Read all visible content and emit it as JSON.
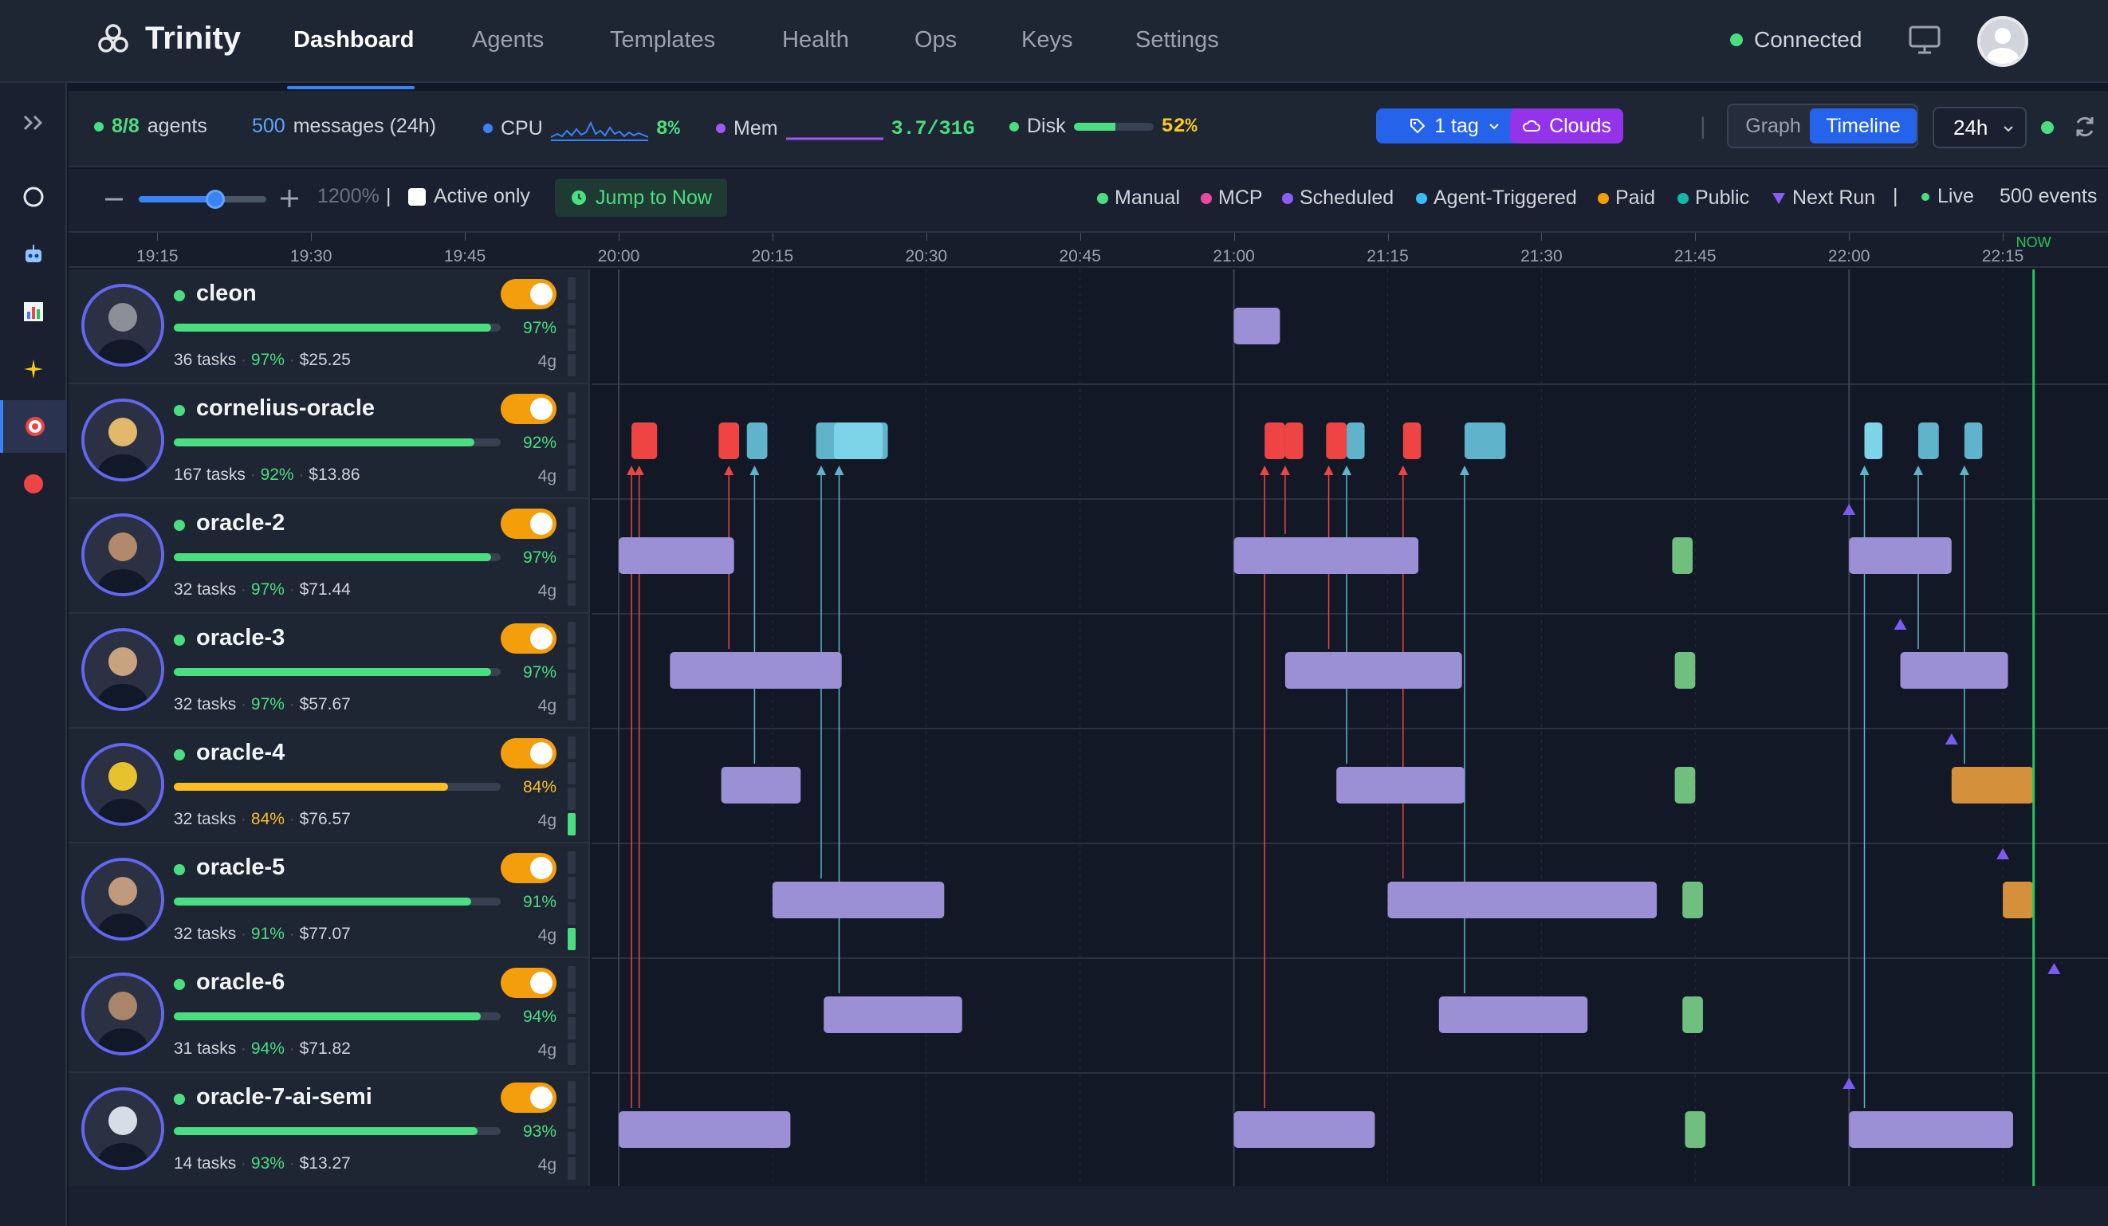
{
  "app": {
    "title": "Trinity"
  },
  "nav": {
    "tabs": [
      {
        "label": "Dashboard",
        "active": true
      },
      {
        "label": "Agents"
      },
      {
        "label": "Templates"
      },
      {
        "label": "Health"
      },
      {
        "label": "Ops"
      },
      {
        "label": "Keys"
      },
      {
        "label": "Settings"
      }
    ],
    "connection": "Connected",
    "connection_color": "#4ade80"
  },
  "rail": {
    "items": [
      {
        "icon": "expand-sidebar-icon"
      },
      {
        "icon": "circle-icon"
      },
      {
        "icon": "robot-icon"
      },
      {
        "icon": "bar-chart-icon"
      },
      {
        "icon": "sparkles-icon"
      },
      {
        "icon": "target-icon",
        "active": true
      },
      {
        "icon": "record-icon"
      }
    ]
  },
  "stats": {
    "agents_count": "8/8",
    "agents_label": "agents",
    "messages_count": "500",
    "messages_label": "messages (24h)",
    "cpu_label": "CPU",
    "cpu_value": "8%",
    "mem_label": "Mem",
    "mem_value": "3.7/31G",
    "disk_label": "Disk",
    "disk_value": "52%",
    "disk_fill": 0.52,
    "tag_filter": "1 tag",
    "clouds_filter": "Clouds",
    "view_graph": "Graph",
    "view_timeline": "Timeline",
    "range": "24h"
  },
  "toolbar": {
    "zoom": "1200%",
    "zoom_level": 0.6,
    "active_only": "Active only",
    "jump_to_now": "Jump to Now",
    "legend": [
      {
        "label": "Manual",
        "color": "#4ade80",
        "shape": "dot"
      },
      {
        "label": "MCP",
        "color": "#ec4899",
        "shape": "dot"
      },
      {
        "label": "Scheduled",
        "color": "#8b5cf6",
        "shape": "dot"
      },
      {
        "label": "Agent-Triggered",
        "color": "#38bdf8",
        "shape": "dot"
      },
      {
        "label": "Paid",
        "color": "#f59e0b",
        "shape": "dot"
      },
      {
        "label": "Public",
        "color": "#14b8a6",
        "shape": "dot"
      },
      {
        "label": "Next Run",
        "color": "#8b5cf6",
        "shape": "triangle"
      }
    ],
    "live": "Live",
    "events": "500 events"
  },
  "axis": {
    "ticks": [
      "19:15",
      "19:30",
      "19:45",
      "20:00",
      "20:15",
      "20:30",
      "20:45",
      "21:00",
      "21:15",
      "21:30",
      "21:45",
      "22:00",
      "22:15"
    ],
    "now_label": "NOW"
  },
  "agents": [
    {
      "name": "cleon",
      "tasks": "36",
      "tasks_label": "tasks",
      "success": "97%",
      "cost": "$25.25",
      "pct": "97%",
      "fill": 0.97,
      "mem": "4g",
      "color": "#4ade80",
      "active_meter": 0
    },
    {
      "name": "cornelius-oracle",
      "tasks": "167",
      "tasks_label": "tasks",
      "success": "92%",
      "cost": "$13.86",
      "pct": "92%",
      "fill": 0.92,
      "mem": "4g",
      "color": "#4ade80",
      "active_meter": 0
    },
    {
      "name": "oracle-2",
      "tasks": "32",
      "tasks_label": "tasks",
      "success": "97%",
      "cost": "$71.44",
      "pct": "97%",
      "fill": 0.97,
      "mem": "4g",
      "color": "#4ade80",
      "active_meter": 0
    },
    {
      "name": "oracle-3",
      "tasks": "32",
      "tasks_label": "tasks",
      "success": "97%",
      "cost": "$57.67",
      "pct": "97%",
      "fill": 0.97,
      "mem": "4g",
      "color": "#4ade80",
      "active_meter": 0
    },
    {
      "name": "oracle-4",
      "tasks": "32",
      "tasks_label": "tasks",
      "success": "84%",
      "cost": "$76.57",
      "pct": "84%",
      "fill": 0.84,
      "mem": "4g",
      "color": "#fbbf24",
      "active_meter": 1
    },
    {
      "name": "oracle-5",
      "tasks": "32",
      "tasks_label": "tasks",
      "success": "91%",
      "cost": "$77.07",
      "pct": "91%",
      "fill": 0.91,
      "mem": "4g",
      "color": "#4ade80",
      "active_meter": 1
    },
    {
      "name": "oracle-6",
      "tasks": "31",
      "tasks_label": "tasks",
      "success": "94%",
      "cost": "$71.82",
      "pct": "94%",
      "fill": 0.94,
      "mem": "4g",
      "color": "#4ade80",
      "active_meter": 0
    },
    {
      "name": "oracle-7-ai-semi",
      "tasks": "14",
      "tasks_label": "tasks",
      "success": "93%",
      "cost": "$13.27",
      "pct": "93%",
      "fill": 0.93,
      "mem": "4g",
      "color": "#4ade80",
      "active_meter": 0
    }
  ],
  "timeline": {
    "start": "19:05",
    "end": "22:22",
    "now": "22:18",
    "colors": {
      "scheduled": "#9b8fd6",
      "mcp": "#ef4444",
      "agent_triggered": "#5fb4cc",
      "agent_triggered_light": "#7dd3e8",
      "manual": "#6fbf7f",
      "paid": "#d4903a",
      "next_run": "#7c5cf0",
      "now_line": "#22c55e"
    },
    "events": [
      {
        "row": 0,
        "start": "21:00",
        "end": "21:04:30",
        "kind": "scheduled"
      },
      {
        "row": 1,
        "start": "20:01:15",
        "end": "20:03:45",
        "kind": "mcp"
      },
      {
        "row": 1,
        "start": "20:09:45",
        "end": "20:11:45",
        "kind": "mcp"
      },
      {
        "row": 1,
        "start": "20:12:30",
        "end": "20:14:30",
        "kind": "agent_triggered"
      },
      {
        "row": 1,
        "start": "20:19:15",
        "end": "20:26:15",
        "kind": "agent_triggered"
      },
      {
        "row": 1,
        "start": "20:21:00",
        "end": "20:25:45",
        "kind": "agent_triggered_light"
      },
      {
        "row": 1,
        "start": "21:03",
        "end": "21:05",
        "kind": "mcp"
      },
      {
        "row": 1,
        "start": "21:05",
        "end": "21:06:45",
        "kind": "mcp"
      },
      {
        "row": 1,
        "start": "21:09",
        "end": "21:11",
        "kind": "mcp"
      },
      {
        "row": 1,
        "start": "21:11",
        "end": "21:12:45",
        "kind": "agent_triggered"
      },
      {
        "row": 1,
        "start": "21:16:30",
        "end": "21:18:15",
        "kind": "mcp"
      },
      {
        "row": 1,
        "start": "21:22:30",
        "end": "21:26:30",
        "kind": "agent_triggered"
      },
      {
        "row": 1,
        "start": "22:01:30",
        "end": "22:03:15",
        "kind": "agent_triggered_light"
      },
      {
        "row": 1,
        "start": "22:06:45",
        "end": "22:08:45",
        "kind": "agent_triggered"
      },
      {
        "row": 1,
        "start": "22:11:15",
        "end": "22:13",
        "kind": "agent_triggered"
      },
      {
        "row": 2,
        "start": "20:00",
        "end": "20:11:15",
        "kind": "scheduled"
      },
      {
        "row": 2,
        "start": "21:00",
        "end": "21:18",
        "kind": "scheduled"
      },
      {
        "row": 2,
        "start": "21:42:45",
        "end": "21:44:45",
        "kind": "manual"
      },
      {
        "row": 2,
        "start": "22:00",
        "end": "22:10",
        "kind": "scheduled"
      },
      {
        "row": 3,
        "start": "20:05",
        "end": "20:21:45",
        "kind": "scheduled"
      },
      {
        "row": 3,
        "start": "21:05",
        "end": "21:22:15",
        "kind": "scheduled"
      },
      {
        "row": 3,
        "start": "21:43",
        "end": "21:45",
        "kind": "manual"
      },
      {
        "row": 3,
        "start": "22:05",
        "end": "22:15:30",
        "kind": "scheduled"
      },
      {
        "row": 4,
        "start": "20:10",
        "end": "20:17:45",
        "kind": "scheduled"
      },
      {
        "row": 4,
        "start": "21:10",
        "end": "21:22:30",
        "kind": "scheduled"
      },
      {
        "row": 4,
        "start": "21:43",
        "end": "21:45",
        "kind": "manual"
      },
      {
        "row": 4,
        "start": "22:10",
        "end": "22:18",
        "kind": "paid"
      },
      {
        "row": 5,
        "start": "20:15",
        "end": "20:31:45",
        "kind": "scheduled"
      },
      {
        "row": 5,
        "start": "21:15",
        "end": "21:41:15",
        "kind": "scheduled"
      },
      {
        "row": 5,
        "start": "21:43:45",
        "end": "21:45:45",
        "kind": "manual"
      },
      {
        "row": 5,
        "start": "22:15",
        "end": "22:18",
        "kind": "paid"
      },
      {
        "row": 6,
        "start": "20:20",
        "end": "20:33:30",
        "kind": "scheduled"
      },
      {
        "row": 6,
        "start": "21:20",
        "end": "21:34:30",
        "kind": "scheduled"
      },
      {
        "row": 6,
        "start": "21:43:45",
        "end": "21:45:45",
        "kind": "manual"
      },
      {
        "row": 7,
        "start": "20:00",
        "end": "20:16:45",
        "kind": "scheduled"
      },
      {
        "row": 7,
        "start": "21:00",
        "end": "21:13:45",
        "kind": "scheduled"
      },
      {
        "row": 7,
        "start": "21:44",
        "end": "21:46",
        "kind": "manual"
      },
      {
        "row": 7,
        "start": "22:00",
        "end": "22:16",
        "kind": "scheduled"
      }
    ],
    "links": [
      {
        "from_row": 7,
        "to_row": 1,
        "time": "20:01:15",
        "color": "mcp"
      },
      {
        "from_row": 7,
        "to_row": 1,
        "time": "20:02",
        "color": "mcp"
      },
      {
        "from_row": 3,
        "to_row": 1,
        "time": "20:10:45",
        "color": "mcp"
      },
      {
        "from_row": 4,
        "to_row": 1,
        "time": "20:13:15",
        "color": "agent_triggered"
      },
      {
        "from_row": 5,
        "to_row": 1,
        "time": "20:19:45",
        "color": "agent_triggered"
      },
      {
        "from_row": 6,
        "to_row": 1,
        "time": "20:21:30",
        "color": "agent_triggered"
      },
      {
        "from_row": 7,
        "to_row": 1,
        "time": "21:03",
        "color": "mcp"
      },
      {
        "from_row": 2,
        "to_row": 1,
        "time": "21:05",
        "color": "mcp"
      },
      {
        "from_row": 3,
        "to_row": 1,
        "time": "21:09:15",
        "color": "mcp"
      },
      {
        "from_row": 4,
        "to_row": 1,
        "time": "21:11",
        "color": "agent_triggered"
      },
      {
        "from_row": 5,
        "to_row": 1,
        "time": "21:16:30",
        "color": "mcp"
      },
      {
        "from_row": 6,
        "to_row": 1,
        "time": "21:22:30",
        "color": "agent_triggered"
      },
      {
        "from_row": 7,
        "to_row": 1,
        "time": "22:01:30",
        "color": "agent_triggered"
      },
      {
        "from_row": 3,
        "to_row": 1,
        "time": "22:06:45",
        "color": "agent_triggered"
      },
      {
        "from_row": 4,
        "to_row": 1,
        "time": "22:11:15",
        "color": "agent_triggered"
      }
    ],
    "next_runs": [
      {
        "row": 2,
        "time": "22:00"
      },
      {
        "row": 3,
        "time": "22:05"
      },
      {
        "row": 4,
        "time": "22:10"
      },
      {
        "row": 5,
        "time": "22:15"
      },
      {
        "row": 6,
        "time": "22:20"
      },
      {
        "row": 7,
        "time": "22:00"
      }
    ]
  }
}
